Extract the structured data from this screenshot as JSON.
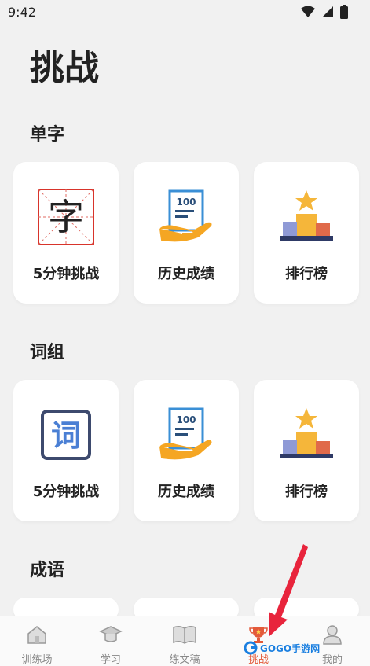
{
  "status": {
    "time": "9:42"
  },
  "page": {
    "title": "挑战"
  },
  "sections": [
    {
      "title": "单字",
      "cards": [
        {
          "label": "5分钟挑战",
          "glyph": "字",
          "icon": "character-grid-icon"
        },
        {
          "label": "历史成绩",
          "score": "100",
          "icon": "score-sheet-hand-icon"
        },
        {
          "label": "排行榜",
          "icon": "podium-star-icon"
        }
      ]
    },
    {
      "title": "词组",
      "cards": [
        {
          "label": "5分钟挑战",
          "glyph": "词",
          "icon": "word-box-icon"
        },
        {
          "label": "历史成绩",
          "score": "100",
          "icon": "score-sheet-hand-icon"
        },
        {
          "label": "排行榜",
          "icon": "podium-star-icon"
        }
      ]
    },
    {
      "title": "成语"
    }
  ],
  "tabs": [
    {
      "label": "训练场",
      "icon": "house-icon"
    },
    {
      "label": "学习",
      "icon": "graduation-cap-icon"
    },
    {
      "label": "练文稿",
      "icon": "open-book-icon"
    },
    {
      "label": "挑战",
      "icon": "trophy-icon",
      "active": true
    },
    {
      "label": "我的",
      "icon": "user-icon"
    }
  ],
  "watermark": {
    "text": "GOGO手游网"
  },
  "colors": {
    "accent": "#e35a3a",
    "arrow": "#e8243c",
    "podium": "#f5b63a"
  }
}
